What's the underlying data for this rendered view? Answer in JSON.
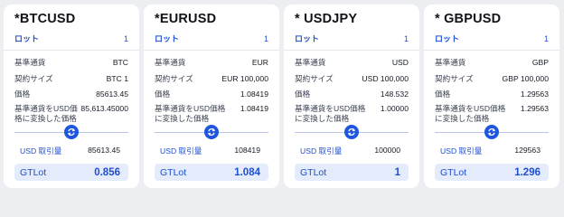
{
  "cards": [
    {
      "title": "*BTCUSD",
      "lot_label": "ロット",
      "lot_value": "1",
      "base_label": "基準通貨",
      "base_value": "BTC",
      "size_label": "契約サイズ",
      "size_value": "BTC 1",
      "price_label": "価格",
      "price_value": "85613.45",
      "conv_label": "基準通貨をUSD価格に変換した価格",
      "conv_value": "85,613.45000",
      "usd_label": "USD 取引量",
      "usd_value": "85613.45",
      "gt_label": "GTLot",
      "gt_value": "0.856"
    },
    {
      "title": "*EURUSD",
      "lot_label": "ロット",
      "lot_value": "1",
      "base_label": "基準通貨",
      "base_value": "EUR",
      "size_label": "契約サイズ",
      "size_value": "EUR 100,000",
      "price_label": "価格",
      "price_value": "1.08419",
      "conv_label": "基準通貨をUSD価格に変換した価格",
      "conv_value": "1.08419",
      "usd_label": "USD 取引量",
      "usd_value": "108419",
      "gt_label": "GTLot",
      "gt_value": "1.084"
    },
    {
      "title": "* USDJPY",
      "lot_label": "ロット",
      "lot_value": "1",
      "base_label": "基準通貨",
      "base_value": "USD",
      "size_label": "契約サイズ",
      "size_value": "USD 100,000",
      "price_label": "価格",
      "price_value": "148.532",
      "conv_label": "基準通貨をUSD価格に変換した価格",
      "conv_value": "1.00000",
      "usd_label": "USD 取引量",
      "usd_value": "100000",
      "gt_label": "GTLot",
      "gt_value": "1"
    },
    {
      "title": "* GBPUSD",
      "lot_label": "ロット",
      "lot_value": "1",
      "base_label": "基準通貨",
      "base_value": "GBP",
      "size_label": "契約サイズ",
      "size_value": "GBP 100,000",
      "price_label": "価格",
      "price_value": "1.29563",
      "conv_label": "基準通貨をUSD価格に変換した価格",
      "conv_value": "1.29563",
      "usd_label": "USD 取引量",
      "usd_value": "129563",
      "gt_label": "GTLot",
      "gt_value": "1.296"
    }
  ],
  "icons": {
    "swap": "swap-arrows-icon"
  },
  "colors": {
    "accent": "#1f56e0",
    "background": "#eceef2",
    "gt_box": "#e4ebfb"
  }
}
